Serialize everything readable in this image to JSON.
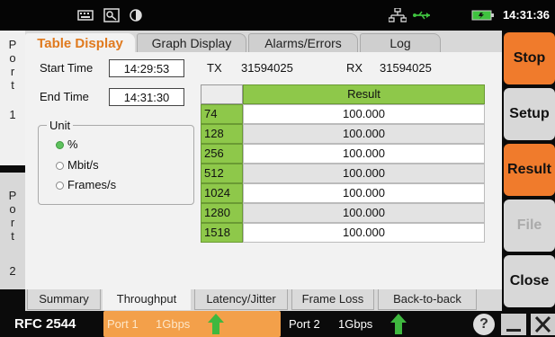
{
  "topbar": {
    "clock": "14:31:36"
  },
  "port_tabs": [
    {
      "letters": [
        "P",
        "o",
        "r",
        "t"
      ],
      "number": "1"
    },
    {
      "letters": [
        "P",
        "o",
        "r",
        "t"
      ],
      "number": "2"
    }
  ],
  "tabs": [
    "Table Display",
    "Graph Display",
    "Alarms/Errors",
    "Log"
  ],
  "active_tab": "Table Display",
  "info": {
    "start_label": "Start Time",
    "start_value": "14:29:53",
    "end_label": "End Time",
    "end_value": "14:31:30",
    "tx_label": "TX",
    "tx_value": "31594025",
    "rx_label": "RX",
    "rx_value": "31594025"
  },
  "unit": {
    "legend": "Unit",
    "options": [
      "%",
      "Mbit/s",
      "Frames/s"
    ],
    "selected": "%"
  },
  "table": {
    "header": "Result",
    "rows": [
      {
        "key": "74",
        "value": "100.000"
      },
      {
        "key": "128",
        "value": "100.000"
      },
      {
        "key": "256",
        "value": "100.000"
      },
      {
        "key": "512",
        "value": "100.000"
      },
      {
        "key": "1024",
        "value": "100.000"
      },
      {
        "key": "1280",
        "value": "100.000"
      },
      {
        "key": "1518",
        "value": "100.000"
      }
    ]
  },
  "bottom_tabs": [
    "Summary",
    "Throughput",
    "Latency/Jitter",
    "Frame Loss",
    "Back-to-back"
  ],
  "active_bottom_tab": "Throughput",
  "buttons": {
    "stop": "Stop",
    "setup": "Setup",
    "result": "Result",
    "file": "File",
    "close": "Close"
  },
  "statusbar": {
    "test": "RFC 2544",
    "port1": "Port 1",
    "port1_speed": "1Gbps",
    "port2": "Port 2",
    "port2_speed": "1Gbps",
    "help": "?"
  },
  "colors": {
    "accent": "#f07b2c",
    "green": "#8ec84a",
    "port1_bg": "#f3a04a"
  }
}
